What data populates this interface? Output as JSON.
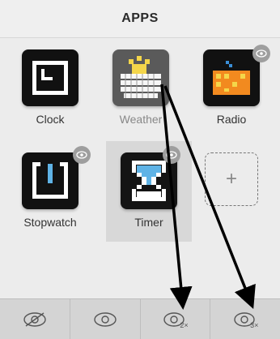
{
  "header": {
    "title": "APPS"
  },
  "apps": [
    {
      "label": "Clock",
      "icon": "clock-icon"
    },
    {
      "label": "Weather",
      "icon": "weather-icon"
    },
    {
      "label": "Radio",
      "icon": "radio-icon"
    },
    {
      "label": "Stopwatch",
      "icon": "stopwatch-icon"
    },
    {
      "label": "Timer",
      "icon": "timer-icon"
    }
  ],
  "add_slot": {
    "symbol": "+"
  },
  "toolbar": {
    "buttons": [
      {
        "icon": "eye-hidden-icon",
        "suffix": ""
      },
      {
        "icon": "eye-icon",
        "suffix": ""
      },
      {
        "icon": "eye-2x-icon",
        "suffix": "2×"
      },
      {
        "icon": "eye-3x-icon",
        "suffix": "3×"
      }
    ]
  },
  "colors": {
    "header_bg": "#efefef",
    "selected_cell": "#d8d8d8",
    "toolbar_bg": "#d4d4d4",
    "timer_blue": "#5fb3e6",
    "radio_orange": "#f28a1f",
    "weather_yellow": "#f4d64a"
  }
}
